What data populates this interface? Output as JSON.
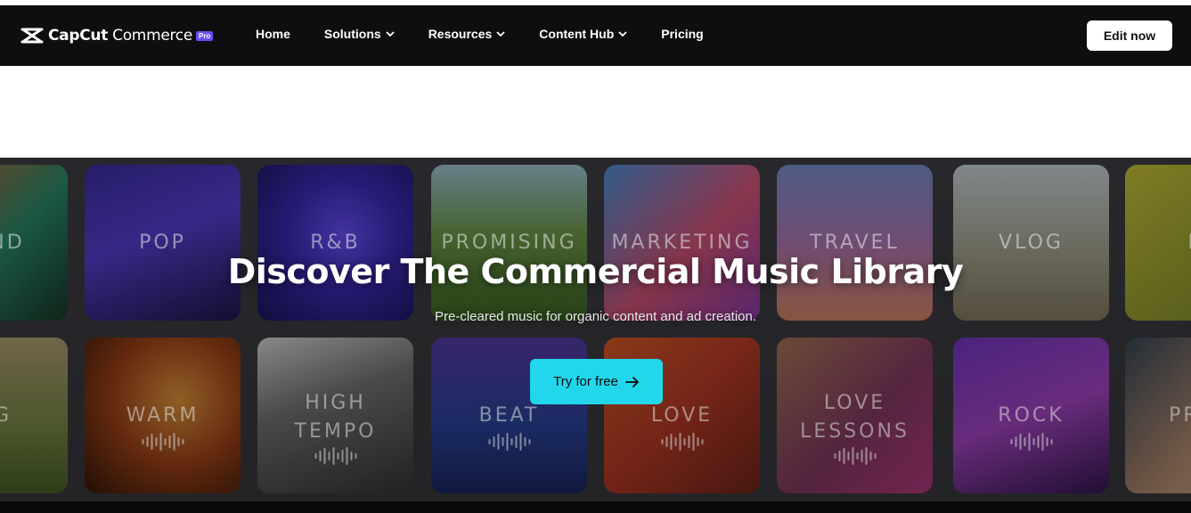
{
  "brand": {
    "name_bold": "CapCut",
    "name_light": "Commerce",
    "badge": "Pro"
  },
  "nav": {
    "items": [
      {
        "label": "Home",
        "dropdown": false
      },
      {
        "label": "Solutions",
        "dropdown": true
      },
      {
        "label": "Resources",
        "dropdown": true
      },
      {
        "label": "Content Hub",
        "dropdown": true
      },
      {
        "label": "Pricing",
        "dropdown": false
      }
    ],
    "cta_label": "Edit now"
  },
  "hero": {
    "title": "Discover The Commercial Music Library",
    "subtitle": "Pre-cleared music for organic content and ad creation.",
    "cta_label": "Try for free"
  },
  "tiles_row1": [
    "MEND",
    "POP",
    "R&B",
    "PROMISING",
    "MARKETING",
    "TRAVEL",
    "VLOG",
    "FR"
  ],
  "tiles_row2": [
    "ING",
    "WARM",
    "HIGH TEMPO",
    "BEAT",
    "LOVE",
    "LOVE LESSONS",
    "ROCK",
    "PROM"
  ],
  "colors": {
    "nav_bg": "#0e0e10",
    "cta": "#22d7ec",
    "pro_badge": "#6b4df6"
  }
}
